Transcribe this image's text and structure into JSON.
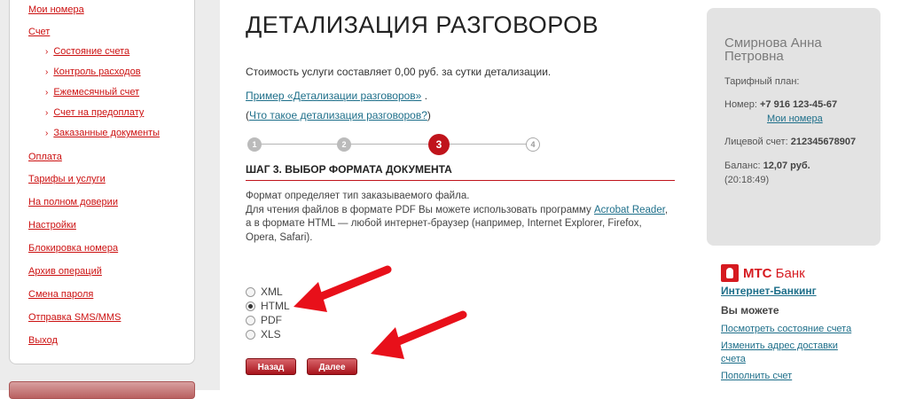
{
  "sidebar": {
    "items": [
      {
        "label": "Мои номера"
      },
      {
        "label": "Счет"
      },
      {
        "label": "Оплата"
      },
      {
        "label": "Тарифы и услуги"
      },
      {
        "label": "На полном доверии"
      },
      {
        "label": "Настройки"
      },
      {
        "label": "Блокировка номера"
      },
      {
        "label": "Архив операций"
      },
      {
        "label": "Смена пароля"
      },
      {
        "label": "Отправка SMS/MMS"
      },
      {
        "label": "Выход"
      }
    ],
    "subitems": [
      {
        "label": "Состояние счета"
      },
      {
        "label": "Контроль расходов"
      },
      {
        "label": "Ежемесячный счет"
      },
      {
        "label": "Счет на предоплату"
      },
      {
        "label": "Заказанные документы"
      }
    ]
  },
  "main": {
    "title": "ДЕТАЛИЗАЦИЯ РАЗГОВОРОВ",
    "cost_text": "Стоимость услуги составляет 0,00 руб. за сутки детализации.",
    "example_link": "Пример «Детализации разговоров»",
    "example_suffix": ".",
    "what_open": "(",
    "what_link": "Что такое детализация разговоров?",
    "what_close": ")",
    "steps": [
      "1",
      "2",
      "3",
      "4"
    ],
    "active_step": 3,
    "step_heading": "ШАГ 3. ВЫБОР ФОРМАТА ДОКУМЕНТА",
    "desc_line1": "Формат определяет тип заказываемого файла.",
    "desc_line2_prefix": "Для чтения файлов в формате PDF Вы можете использовать программу ",
    "desc_line2_link": "Acrobat Reader",
    "desc_line2_suffix": ",",
    "desc_line3": "а в формате HTML — любой интернет-браузер (например, Internet Explorer, Firefox, Opera, Safari).",
    "formats": [
      {
        "label": "XML",
        "checked": false
      },
      {
        "label": "HTML",
        "checked": true
      },
      {
        "label": "PDF",
        "checked": false
      },
      {
        "label": "XLS",
        "checked": false
      }
    ],
    "back_button": "Назад",
    "next_button": "Далее",
    "accent_color": "#c0141c",
    "arrow_color": "#e8101a"
  },
  "account": {
    "name": "Смирнова Анна Петровна",
    "tariff_label": "Тарифный план:",
    "number_label": "Номер:",
    "number_value": "+7 916 123-45-67",
    "my_numbers_link": "Мои номера",
    "account_label": "Лицевой счет:",
    "account_value": "212345678907",
    "balance_label": "Баланс:",
    "balance_value": "12,07 руб.",
    "balance_time": "(20:18:49)"
  },
  "bank": {
    "brand": "МТС",
    "brand_suffix": "Банк",
    "ib_link": "Интернет-Банкинг",
    "can_do": "Вы можете",
    "links": [
      {
        "label": "Посмотреть состояние счета"
      },
      {
        "label": "Изменить адрес доставки"
      },
      {
        "label": "счета"
      },
      {
        "label": "Пополнить счет"
      }
    ]
  }
}
